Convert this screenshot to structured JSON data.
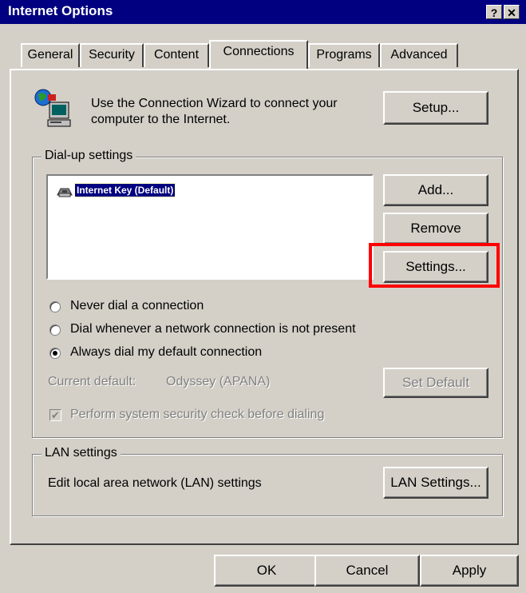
{
  "window": {
    "title": "Internet Options",
    "help_button": "?",
    "close_button": "✕"
  },
  "tabs": [
    {
      "label": "General"
    },
    {
      "label": "Security"
    },
    {
      "label": "Content"
    },
    {
      "label": "Connections",
      "active": true
    },
    {
      "label": "Programs"
    },
    {
      "label": "Advanced"
    }
  ],
  "wizard": {
    "text_line1": "Use the Connection Wizard to connect your",
    "text_line2": "computer to the Internet.",
    "setup_label": "Setup...",
    "icon": "connection-wizard-icon"
  },
  "dialup": {
    "group_label": "Dial-up settings",
    "list_items": [
      {
        "label": "Internet Key (Default)",
        "selected": true,
        "icon": "dialup-connection-icon"
      }
    ],
    "add_label": "Add...",
    "remove_label": "Remove",
    "settings_label": "Settings...",
    "radio_options": [
      {
        "label": "Never dial a connection",
        "checked": false
      },
      {
        "label": "Dial whenever a network connection is not present",
        "checked": false
      },
      {
        "label": "Always dial my default connection",
        "checked": true
      }
    ],
    "current_default_label": "Current default:",
    "current_default_value": "Odyssey (APANA)",
    "set_default_label": "Set Default",
    "security_check_label": "Perform system security check before dialing",
    "security_check_checked": true
  },
  "lan": {
    "group_label": "LAN settings",
    "description": "Edit local area network (LAN) settings",
    "button_label": "LAN Settings..."
  },
  "footer": {
    "ok_label": "OK",
    "cancel_label": "Cancel",
    "apply_label": "Apply"
  },
  "colors": {
    "titlebar": "#000080",
    "highlight_box": "#ff0000",
    "selection": "#000080"
  }
}
